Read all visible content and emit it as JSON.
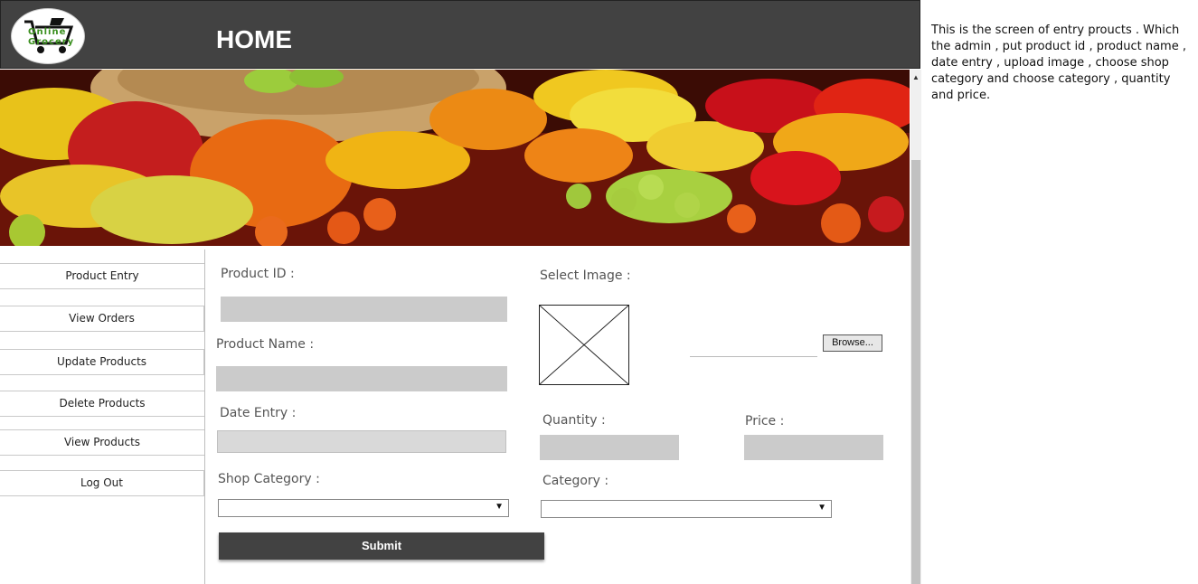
{
  "header": {
    "title": "HOME",
    "logo_text": "Online Grocery",
    "bg_color": "#424242"
  },
  "banner": {
    "alt": "fruit-and-vegetable-banner"
  },
  "sidebar": {
    "items": [
      {
        "label": "Product Entry"
      },
      {
        "label": "View Orders"
      },
      {
        "label": "Update Products"
      },
      {
        "label": "Delete Products"
      },
      {
        "label": "View Products"
      },
      {
        "label": "Log Out"
      }
    ]
  },
  "form": {
    "product_id_label": "Product ID :",
    "product_id_value": "",
    "product_name_label": "Product Name :",
    "product_name_value": "",
    "date_entry_label": "Date Entry :",
    "date_entry_value": "",
    "shop_category_label": "Shop Category :",
    "shop_category_value": "",
    "select_image_label": "Select Image :",
    "browse_label": "Browse...",
    "quantity_label": "Quantity :",
    "quantity_value": "",
    "price_label": "Price :",
    "price_value": "",
    "category_label": "Category :",
    "category_value": "",
    "submit_label": "Submit"
  },
  "note": {
    "text": "This is the screen of entry proucts . Which the admin , put product id , product name , date entry , upload image , choose shop category and choose category  , quantity and price."
  }
}
